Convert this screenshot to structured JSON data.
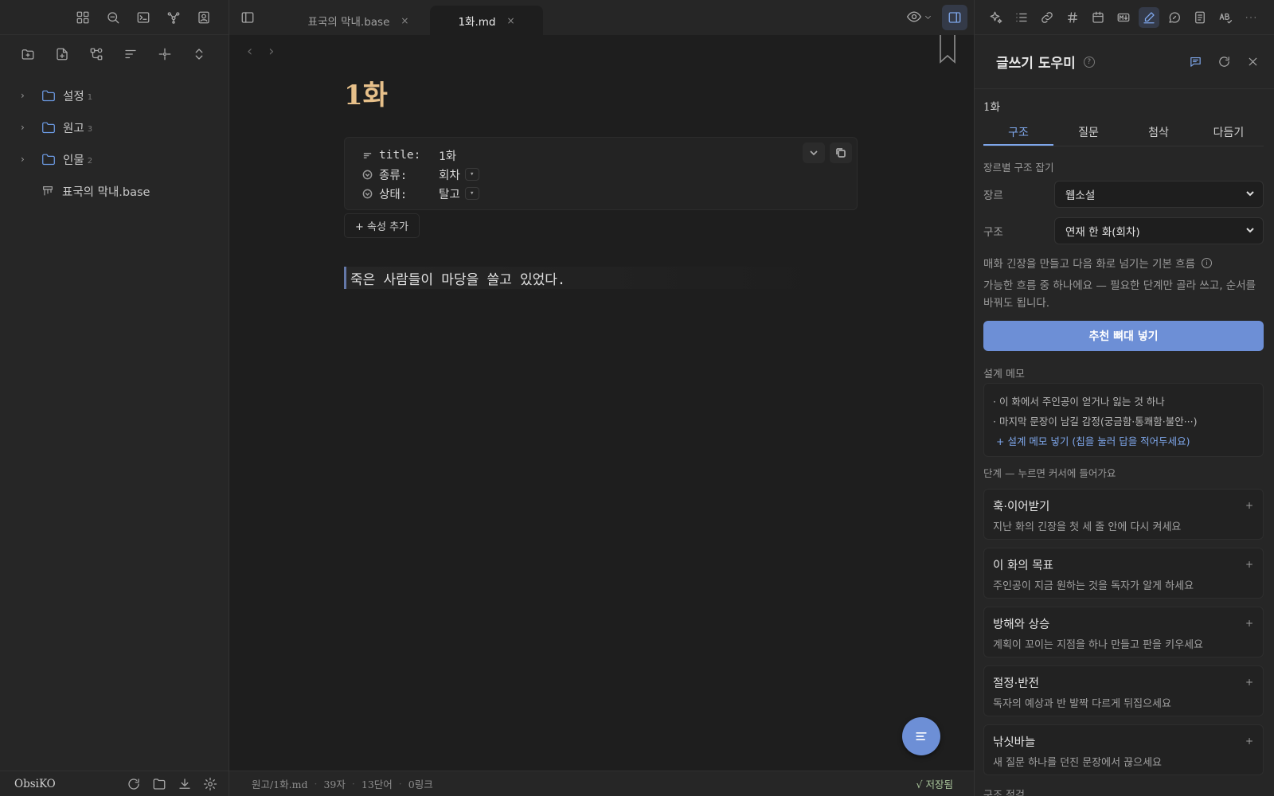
{
  "left_sidebar": {
    "tree": [
      {
        "label": "설정",
        "count": "1"
      },
      {
        "label": "원고",
        "count": "3"
      },
      {
        "label": "인물",
        "count": "2"
      }
    ],
    "file": {
      "label": "표국의 막내.base"
    },
    "vault_name": "ObsiKO"
  },
  "tabs": [
    {
      "label": "표국의 막내.base",
      "close": "×"
    },
    {
      "label": "1화.md",
      "close": "×"
    }
  ],
  "editor": {
    "title": "1화",
    "properties": [
      {
        "key": "title:",
        "value": "1화",
        "icon": "text-lines-icon",
        "has_dropdown": false
      },
      {
        "key": "종류:",
        "value": "회차",
        "icon": "circle-chevron-icon",
        "has_dropdown": true
      },
      {
        "key": "상태:",
        "value": "탈고",
        "icon": "circle-chevron-icon",
        "has_dropdown": true
      }
    ],
    "add_property": "+ 속성 추가",
    "body_text": "죽은 사람들이 마당을 쓸고 있었다.",
    "dropdown_glyph": "▾"
  },
  "statusbar": {
    "path": "원고/1화.md",
    "chars": "39자",
    "words": "13단어",
    "links": "0링크",
    "saved": "√ 저장됨"
  },
  "right_panel": {
    "title": "글쓰기 도우미",
    "help": "?",
    "doc_name": "1화",
    "tabs": [
      "구조",
      "질문",
      "첨삭",
      "다듬기"
    ],
    "active_tab": 0,
    "section_label": "장르별 구조 잡기",
    "genre_label": "장르",
    "genre_value": "웹소설",
    "structure_label": "구조",
    "structure_value": "연재 한 화(회차)",
    "desc1": "매화 긴장을 만들고 다음 화로 넘기는 기본 흐름",
    "info": "i",
    "desc2": "가능한 흐름 중 하나에요 — 필요한 단계만 골라 쓰고, 순서를 바꿔도 됩니다.",
    "primary_button": "추천 뼈대 넣기",
    "memo_label": "설계 메모",
    "memo_items": [
      "· 이 화에서 주인공이 얻거나 잃는 것 하나",
      "· 마지막 문장이 남길 감정(궁금함·통쾌함·불안···)"
    ],
    "memo_add": "+ 설계 메모 넣기 (칩을 눌러 답을 적어두세요)",
    "steps_label": "단계 — 누르면 커서에 들어가요",
    "steps": [
      {
        "title": "훅·이어받기",
        "desc": "지난 화의 긴장을 첫 세 줄 안에 다시 켜세요",
        "plus": "+"
      },
      {
        "title": "이 화의 목표",
        "desc": "주인공이 지금 원하는 것을 독자가 알게 하세요",
        "plus": "+"
      },
      {
        "title": "방해와 상승",
        "desc": "계획이 꼬이는 지점을 하나 만들고 판을 키우세요",
        "plus": "+"
      },
      {
        "title": "절정·반전",
        "desc": "독자의 예상과 반 발짝 다르게 뒤집으세요",
        "plus": "+"
      },
      {
        "title": "낚싯바늘",
        "desc": "새 질문 하나를 던진 문장에서 끊으세요",
        "plus": "+"
      }
    ],
    "cut_text": "구조 점검"
  },
  "colors": {
    "accent": "#6d8fd6",
    "title": "#e7c08a",
    "folder": "#6d9ce6",
    "saved": "#a8c49a"
  }
}
